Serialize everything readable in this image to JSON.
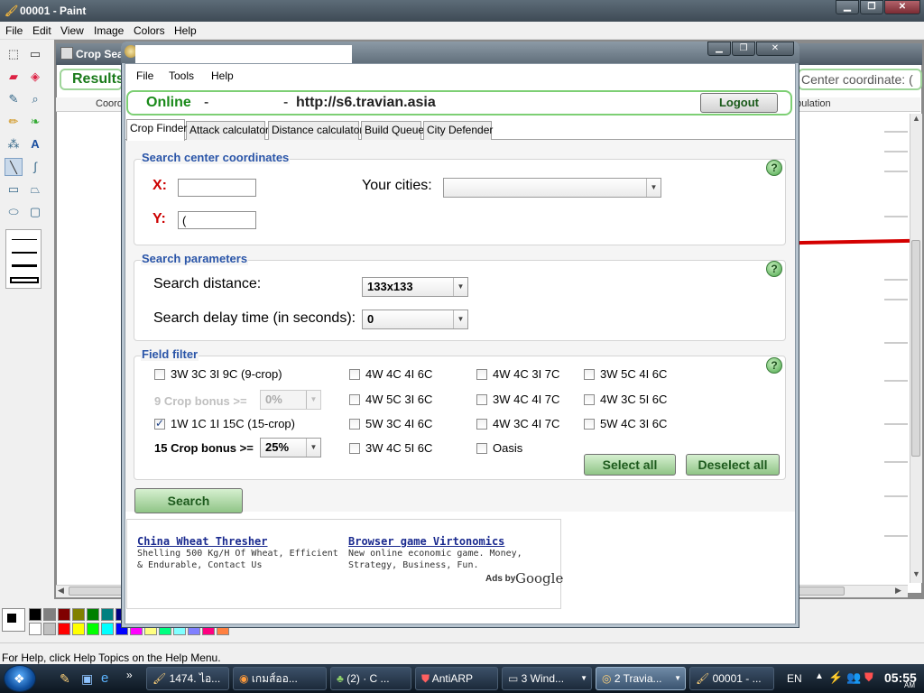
{
  "paint": {
    "title": "00001 - Paint",
    "menu": [
      "File",
      "Edit",
      "View",
      "Image",
      "Colors",
      "Help"
    ],
    "status": "For Help, click Help Topics on the Help Menu.",
    "palette": [
      "#000000",
      "#808080",
      "#800000",
      "#808000",
      "#008000",
      "#008080",
      "#000080",
      "#800080",
      "#808040",
      "#004040",
      "#0080ff",
      "#004080",
      "#8000ff",
      "#804000",
      "#ffffff",
      "#c0c0c0",
      "#ff0000",
      "#ffff00",
      "#00ff00",
      "#00ffff",
      "#0000ff",
      "#ff00ff",
      "#ffff80",
      "#00ff80",
      "#80ffff",
      "#8080ff",
      "#ff0080",
      "#ff8040"
    ]
  },
  "background_app": {
    "title": "Crop Sea",
    "results": "Results",
    "center_coordinate": "Center coordinate: (",
    "col_coord": "Coord",
    "col_population": "opulation"
  },
  "crop_finder": {
    "menu": [
      "File",
      "Tools",
      "Help"
    ],
    "status": "Online",
    "dash1": "-",
    "dash2": "-",
    "server_url": "http://s6.travian.asia",
    "logout": "Logout",
    "tabs": [
      "Crop Finder",
      "Attack calculator",
      "Distance calculator",
      "Build Queue",
      "City Defender"
    ],
    "search_center": {
      "legend": "Search center coordinates",
      "x_label": "X:",
      "y_label": "Y:",
      "x_value": "",
      "y_value": "(",
      "cities_label": "Your cities:",
      "cities_value": ""
    },
    "search_params": {
      "legend": "Search parameters",
      "distance_label": "Search distance:",
      "distance_value": "133x133",
      "delay_label": "Search delay time (in seconds):",
      "delay_value": "0"
    },
    "field_filter": {
      "legend": "Field filter",
      "crop9": {
        "label": "3W 3C 3I 9C (9-crop)",
        "checked": false
      },
      "bonus9_label": "9 Crop bonus >=",
      "bonus9_value": "0%",
      "crop15": {
        "label": "1W 1C 1I 15C (15-crop)",
        "checked": true
      },
      "bonus15_label": "15 Crop bonus >=",
      "bonus15_value": "25%",
      "col2": [
        "4W 4C 4I 6C",
        "4W 5C 3I 6C",
        "5W 3C 4I 6C",
        "3W 4C 5I 6C"
      ],
      "col3": [
        "4W 4C 3I 7C",
        "3W 4C 4I 7C",
        "4W 3C 4I 7C",
        "Oasis"
      ],
      "col4": [
        "3W 5C 4I 6C",
        "4W 3C 5I 6C",
        "5W 4C 3I 6C"
      ],
      "select_all": "Select all",
      "deselect_all": "Deselect all"
    },
    "search_button": "Search",
    "ads": {
      "ad1_title": "China Wheat Thresher",
      "ad1_desc": "Shelling 500 Kg/H Of Wheat, Efficient & Endurable, Contact Us",
      "ad2_title": "Browser game Virtonomics",
      "ad2_desc": "New online economic game. Money, Strategy, Business, Fun.",
      "ads_by": "Ads by",
      "google": "Google"
    },
    "help_glyph": "?"
  },
  "taskbar": {
    "items": [
      "1474. ไอ...",
      "เกมส์ออ...",
      "(2) ·    C ...",
      "AntiARP",
      "3 Wind...",
      "2 Travia...",
      "00001 - ..."
    ],
    "active_index": 5,
    "lang": "EN",
    "clock": "05:55",
    "ampm": "AM"
  }
}
